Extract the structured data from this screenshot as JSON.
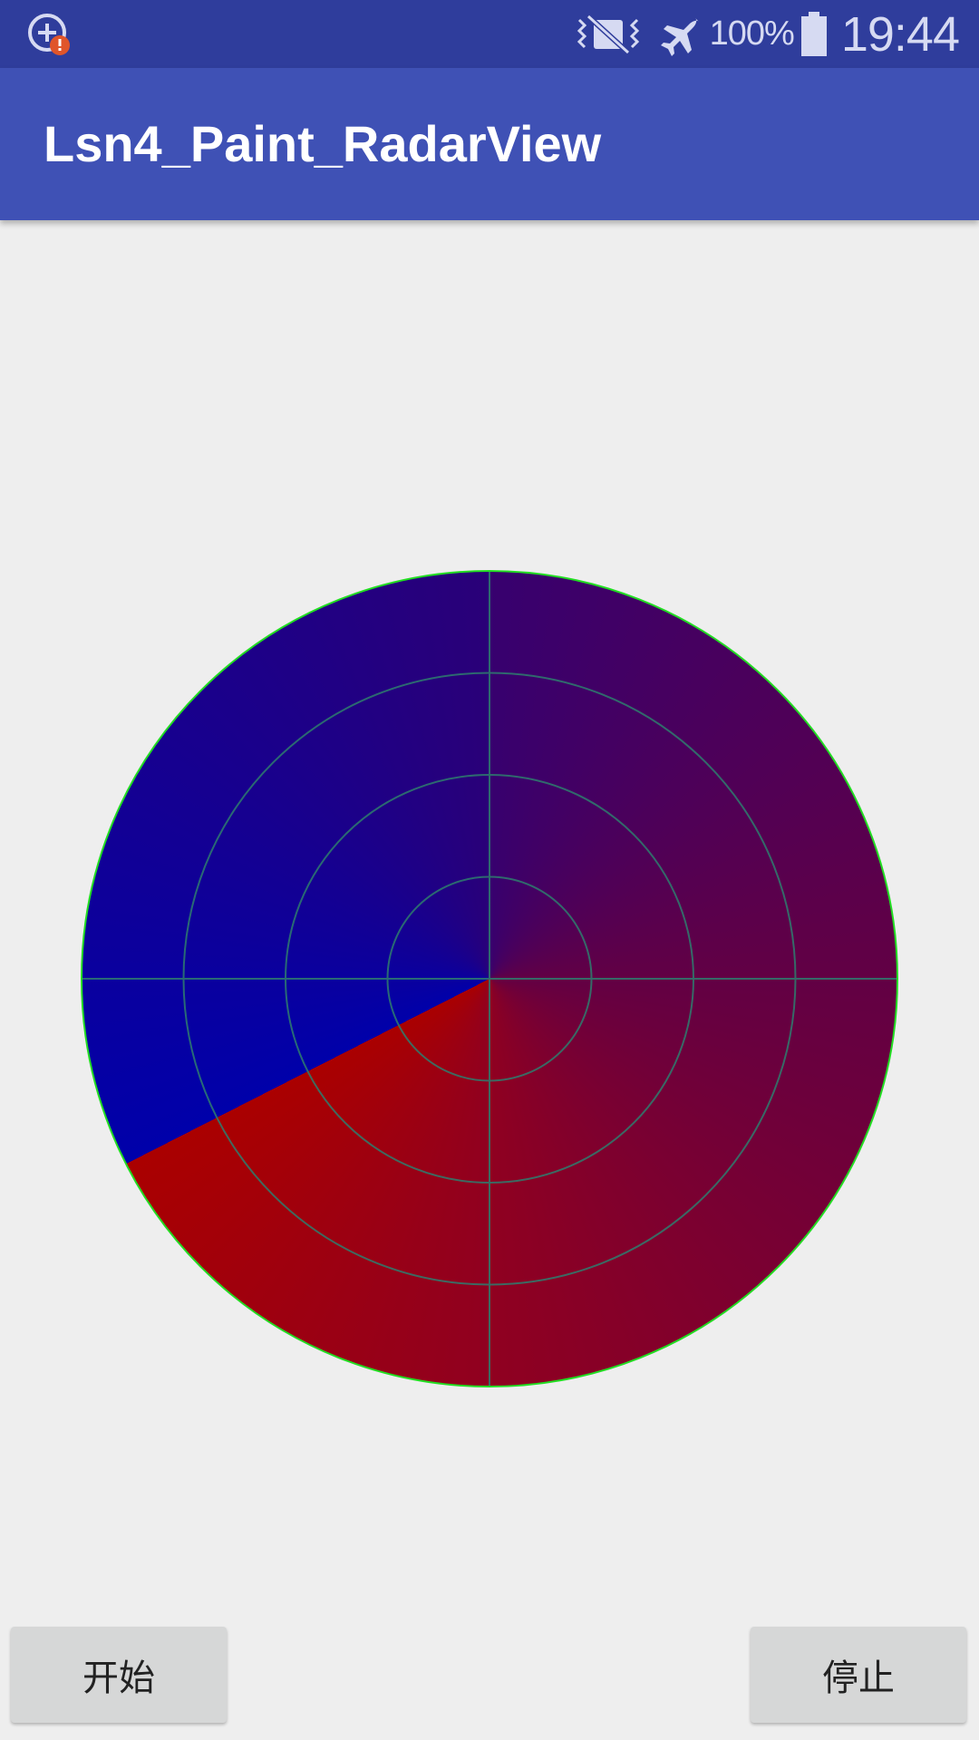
{
  "status_bar": {
    "battery_percent": "100%",
    "battery_level": 1.0,
    "time": "19:44",
    "icons": [
      "add-alert-icon",
      "vibrate-mute-icon",
      "airplane-mode-icon",
      "battery-icon"
    ],
    "background_color": "#2F3D9C"
  },
  "app_bar": {
    "title": "Lsn4_Paint_RadarView",
    "background_color": "#3F51B5"
  },
  "radar": {
    "ring_count": 4,
    "crosshair": true,
    "sweep_angle_degrees": 243,
    "colors": {
      "sweep_start": "#AA0000",
      "sweep_end": "#0000AA",
      "outline": "#22DD22",
      "grid": "#2E7D6E"
    }
  },
  "buttons": {
    "start_label": "开始",
    "stop_label": "停止"
  }
}
